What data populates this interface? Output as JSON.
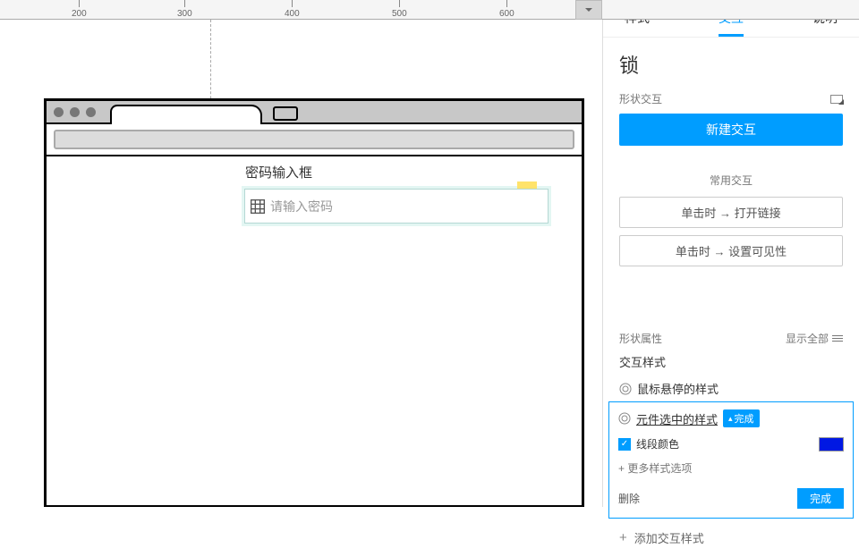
{
  "ruler_ticks": [
    "200",
    "300",
    "400",
    "500",
    "600"
  ],
  "canvas": {
    "label": "密码输入框",
    "placeholder": "请输入密码"
  },
  "panel": {
    "tabs": {
      "style": "样式",
      "interaction": "交互",
      "notes": "说明"
    },
    "widget_name": "锁",
    "section_shape_interactions": "形状交互",
    "btn_new_interaction": "新建交互",
    "common_header": "常用交互",
    "common_open_link": "单击时 → 打开链接",
    "common_set_visibility": "单击时 → 设置可见性",
    "section_shape_props": "形状属性",
    "show_all": "显示全部",
    "style_title": "交互样式",
    "hover_style": "鼠标悬停的样式",
    "selected_style": "元件选中的样式",
    "badge_done": "完成",
    "line_color_label": "线段颜色",
    "line_color_value": "#0018e3",
    "more_styles": "+ 更多样式选项",
    "delete": "删除",
    "done": "完成",
    "add_style": "添加交互样式"
  }
}
